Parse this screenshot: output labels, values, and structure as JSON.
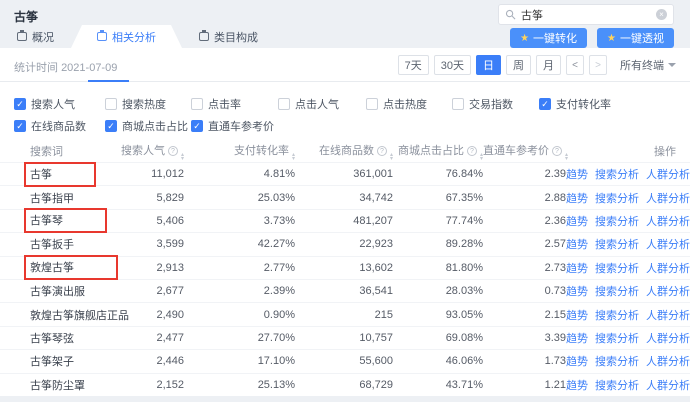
{
  "header": {
    "title": "古筝",
    "search": {
      "value": "古筝"
    },
    "actions": [
      {
        "label": "一键转化"
      },
      {
        "label": "一键透视"
      }
    ]
  },
  "tabs": [
    {
      "label": "概况",
      "active": false
    },
    {
      "label": "相关分析",
      "active": true
    },
    {
      "label": "类目构成",
      "active": false
    }
  ],
  "toolbar": {
    "stat_label": "统计时间",
    "stat_value": "2021-07-09",
    "ranges": [
      {
        "label": "7天",
        "active": false
      },
      {
        "label": "30天",
        "active": false
      },
      {
        "label": "日",
        "active": true
      },
      {
        "label": "周",
        "active": false
      },
      {
        "label": "月",
        "active": false
      }
    ],
    "prev": "<",
    "next": ">",
    "terminal": "所有终端"
  },
  "metrics": {
    "row1": [
      {
        "label": "搜索人气",
        "checked": true
      },
      {
        "label": "搜索热度",
        "checked": false
      },
      {
        "label": "点击率",
        "checked": false
      },
      {
        "label": "点击人气",
        "checked": false
      },
      {
        "label": "点击热度",
        "checked": false
      },
      {
        "label": "交易指数",
        "checked": false
      },
      {
        "label": "支付转化率",
        "checked": true
      }
    ],
    "row2": [
      {
        "label": "在线商品数",
        "checked": true
      },
      {
        "label": "商城点击占比",
        "checked": true
      },
      {
        "label": "直通车参考价",
        "checked": true
      }
    ]
  },
  "table": {
    "headers": [
      {
        "label": "搜索词",
        "info": false,
        "sort": false
      },
      {
        "label": "搜索人气",
        "info": true,
        "sort": true
      },
      {
        "label": "支付转化率",
        "info": false,
        "sort": true
      },
      {
        "label": "在线商品数",
        "info": true,
        "sort": true
      },
      {
        "label": "商城点击占比",
        "info": true,
        "sort": true
      },
      {
        "label": "直通车参考价",
        "info": true,
        "sort": true
      },
      {
        "label": "操作",
        "info": false,
        "sort": false
      }
    ],
    "op_labels": [
      "趋势",
      "搜索分析",
      "人群分析"
    ],
    "rows": [
      {
        "keyword": "古筝",
        "boxed": true,
        "values": [
          "11,012",
          "4.81%",
          "361,001",
          "76.84%",
          "2.39"
        ]
      },
      {
        "keyword": "古筝指甲",
        "boxed": false,
        "values": [
          "5,829",
          "25.03%",
          "34,742",
          "67.35%",
          "2.88"
        ]
      },
      {
        "keyword": "古筝琴",
        "boxed": true,
        "values": [
          "5,406",
          "3.73%",
          "481,207",
          "77.74%",
          "2.36"
        ]
      },
      {
        "keyword": "古筝扳手",
        "boxed": false,
        "values": [
          "3,599",
          "42.27%",
          "22,923",
          "89.28%",
          "2.57"
        ]
      },
      {
        "keyword": "敦煌古筝",
        "boxed": true,
        "values": [
          "2,913",
          "2.77%",
          "13,602",
          "81.80%",
          "2.73"
        ]
      },
      {
        "keyword": "古筝演出服",
        "boxed": false,
        "values": [
          "2,677",
          "2.39%",
          "36,541",
          "28.03%",
          "0.73"
        ]
      },
      {
        "keyword": "敦煌古筝旗舰店正品",
        "boxed": false,
        "values": [
          "2,490",
          "0.90%",
          "215",
          "93.05%",
          "2.15"
        ]
      },
      {
        "keyword": "古筝琴弦",
        "boxed": false,
        "values": [
          "2,477",
          "27.70%",
          "10,757",
          "69.08%",
          "3.39"
        ]
      },
      {
        "keyword": "古筝架子",
        "boxed": false,
        "values": [
          "2,446",
          "17.10%",
          "55,600",
          "46.06%",
          "1.73"
        ]
      },
      {
        "keyword": "古筝防尘罩",
        "boxed": false,
        "values": [
          "2,152",
          "25.13%",
          "68,729",
          "43.71%",
          "1.21"
        ]
      }
    ]
  },
  "colors": {
    "accent": "#3b7ef8",
    "highlight_box": "#e8382e",
    "button_blue": "#4a90fa",
    "star": "#ffd35c"
  }
}
